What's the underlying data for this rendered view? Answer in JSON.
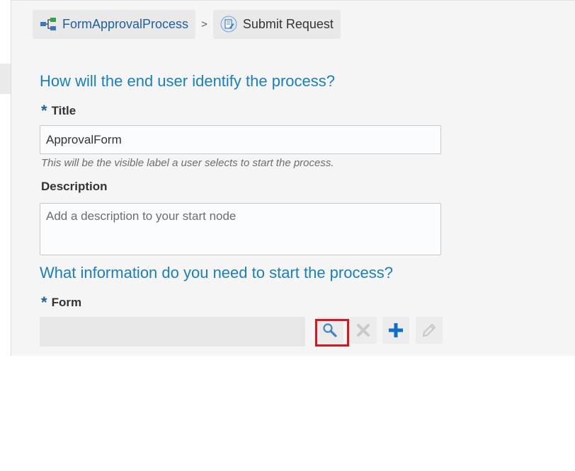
{
  "breadcrumb": {
    "process_label": "FormApprovalProcess",
    "separator": ">",
    "current_label": "Submit Request"
  },
  "section1": {
    "heading": "How will the end user identify the process?",
    "title_label": "Title",
    "required_marker": "*",
    "title_value": "ApprovalForm",
    "title_help": "This will be the visible label a user selects to start the process.",
    "description_label": "Description",
    "description_placeholder": "Add a description to your start node"
  },
  "section2": {
    "heading": "What information do you need to start the process?",
    "form_label": "Form",
    "required_marker": "*"
  },
  "colors": {
    "heading_blue": "#1a7fbf",
    "link_blue": "#1f5f9e",
    "add_blue": "#0f6fc6",
    "disabled_gray": "#c9c9c9",
    "highlight_red": "#e3111a"
  },
  "icons": {
    "process": "process-flow-icon",
    "submit_request": "submit-request-icon",
    "search": "search-icon",
    "clear": "clear-icon",
    "add": "add-icon",
    "edit": "edit-icon"
  }
}
